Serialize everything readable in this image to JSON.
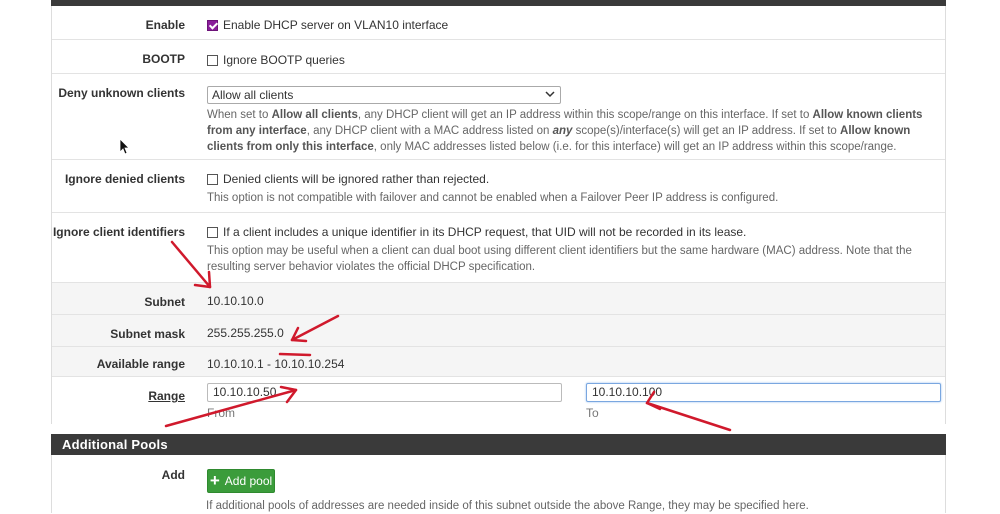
{
  "dhcp": {
    "enable": {
      "label": "Enable",
      "checkbox_text": "Enable DHCP server on VLAN10 interface",
      "checked": true
    },
    "bootp": {
      "label": "BOOTP",
      "checkbox_text": "Ignore BOOTP queries",
      "checked": false
    },
    "deny_unknown": {
      "label": "Deny unknown clients",
      "selected": "Allow all clients",
      "help_1": "When set to ",
      "help_b1": "Allow all clients",
      "help_2": ", any DHCP client will get an IP address within this scope/range on this interface. If set to ",
      "help_b2": "Allow known clients from any interface",
      "help_3": ", any DHCP client with a MAC address listed on ",
      "help_b3": "any",
      "help_4": " scope(s)/interface(s) will get an IP address. If set to ",
      "help_b4": "Allow known clients from only this interface",
      "help_5": ", only MAC addresses listed below (i.e. for this interface) will get an IP address within this scope/range."
    },
    "ignore_denied": {
      "label": "Ignore denied clients",
      "checkbox_text": "Denied clients will be ignored rather than rejected.",
      "checked": false,
      "help": "This option is not compatible with failover and cannot be enabled when a Failover Peer IP address is configured."
    },
    "ignore_client_ids": {
      "label": "Ignore client identifiers",
      "checkbox_text": "If a client includes a unique identifier in its DHCP request, that UID will not be recorded in its lease.",
      "checked": false,
      "help": "This option may be useful when a client can dual boot using different client identifiers but the same hardware (MAC) address. Note that the resulting server behavior violates the official DHCP specification."
    },
    "subnet": {
      "label": "Subnet",
      "value": "10.10.10.0"
    },
    "subnet_mask": {
      "label": "Subnet mask",
      "value": "255.255.255.0"
    },
    "available_range": {
      "label": "Available range",
      "value": "10.10.10.1 - 10.10.10.254"
    },
    "range": {
      "label": "Range",
      "from_value": "10.10.10.50",
      "from_label": "From",
      "to_value": "10.10.10.100",
      "to_label": "To"
    }
  },
  "additional_pools": {
    "heading": "Additional Pools",
    "add_label": "Add",
    "add_button": "Add pool",
    "help": "If additional pools of addresses are needed inside of this subnet outside the above Range, they may be specified here."
  },
  "colors": {
    "header_bg": "#3a3a3a",
    "checkbox_checked": "#8a1e9b",
    "add_button": "#3b9c3b",
    "annotation_arrow": "#d0192c"
  },
  "icons": [
    "checkbox",
    "chevron-down-icon",
    "plus-icon",
    "mouse-cursor-icon",
    "annotation-arrow"
  ]
}
